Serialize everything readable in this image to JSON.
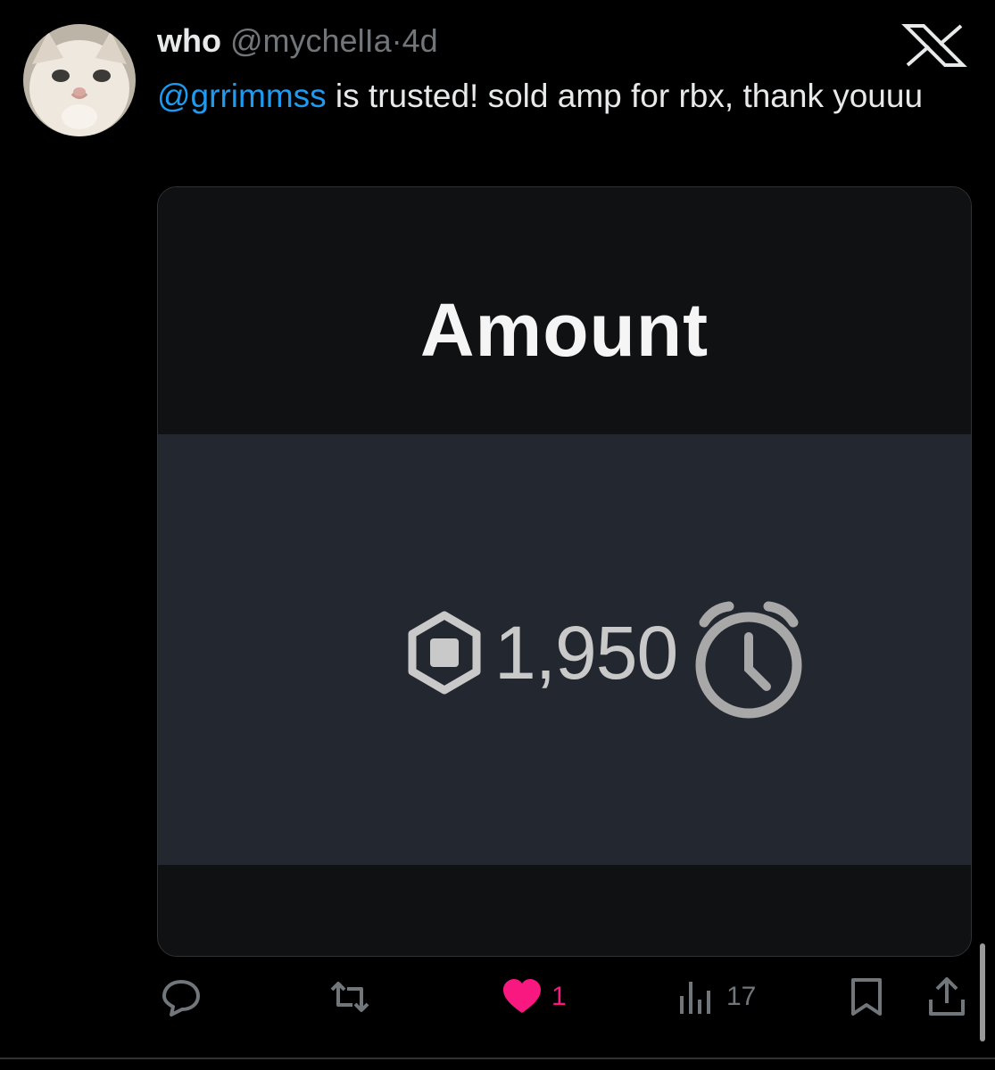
{
  "tweet": {
    "display_name": "who",
    "handle": "@mychelIa",
    "separator": "·",
    "timestamp": "4d",
    "mention": "@grrimmss",
    "text": " is trusted! sold amp for rbx, thank youuu"
  },
  "media": {
    "title": "Amount",
    "amount": "1,950",
    "icons": [
      "robux-icon",
      "alarm-clock-icon"
    ]
  },
  "actions": {
    "reply_count": "",
    "retweet_count": "",
    "like_count": "1",
    "views_count": "17"
  },
  "colors": {
    "background": "#000000",
    "mention": "#1d9bf0",
    "like": "#f91880",
    "muted": "#71767b",
    "card_mid": "#23272f"
  }
}
